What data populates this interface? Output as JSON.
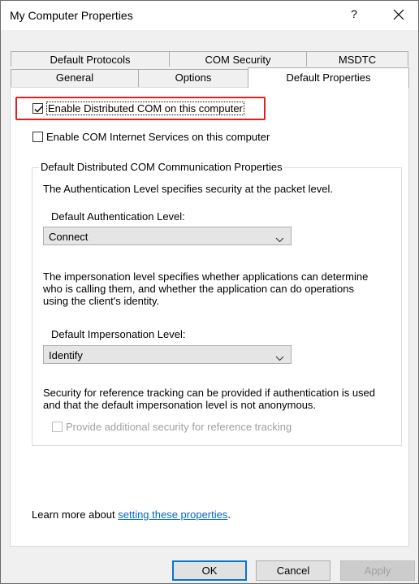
{
  "window": {
    "title": "My Computer Properties",
    "help_label": "?"
  },
  "tabs": {
    "row1": [
      "Default Protocols",
      "COM Security",
      "MSDTC"
    ],
    "row2": [
      "General",
      "Options",
      "Default Properties"
    ],
    "active": "Default Properties"
  },
  "checkboxes": {
    "enable_dcom": {
      "label": "Enable Distributed COM on this computer",
      "checked": true
    },
    "enable_cis": {
      "label": "Enable COM Internet Services on this computer",
      "checked": false
    }
  },
  "group": {
    "legend": "Default Distributed COM Communication Properties",
    "auth_desc": "The Authentication Level specifies security at the packet level.",
    "auth_label": "Default Authentication Level:",
    "auth_value": "Connect",
    "imp_desc_1": "The impersonation level specifies whether applications can determine",
    "imp_desc_2": "who is calling them, and whether the application can do operations",
    "imp_desc_3": "using the client's identity.",
    "imp_label": "Default Impersonation Level:",
    "imp_value": "Identify",
    "ref_desc_1": "Security for reference tracking can be provided if authentication is used",
    "ref_desc_2": "and that the default impersonation level is not anonymous.",
    "ref_checkbox_label": "Provide additional security for reference tracking"
  },
  "learn_more": {
    "prefix": "Learn more about ",
    "link": "setting these properties",
    "suffix": "."
  },
  "buttons": {
    "ok": "OK",
    "cancel": "Cancel",
    "apply": "Apply"
  },
  "colors": {
    "highlight": "#e02020",
    "link": "#0066cc",
    "default_button_border": "#0078d7"
  }
}
